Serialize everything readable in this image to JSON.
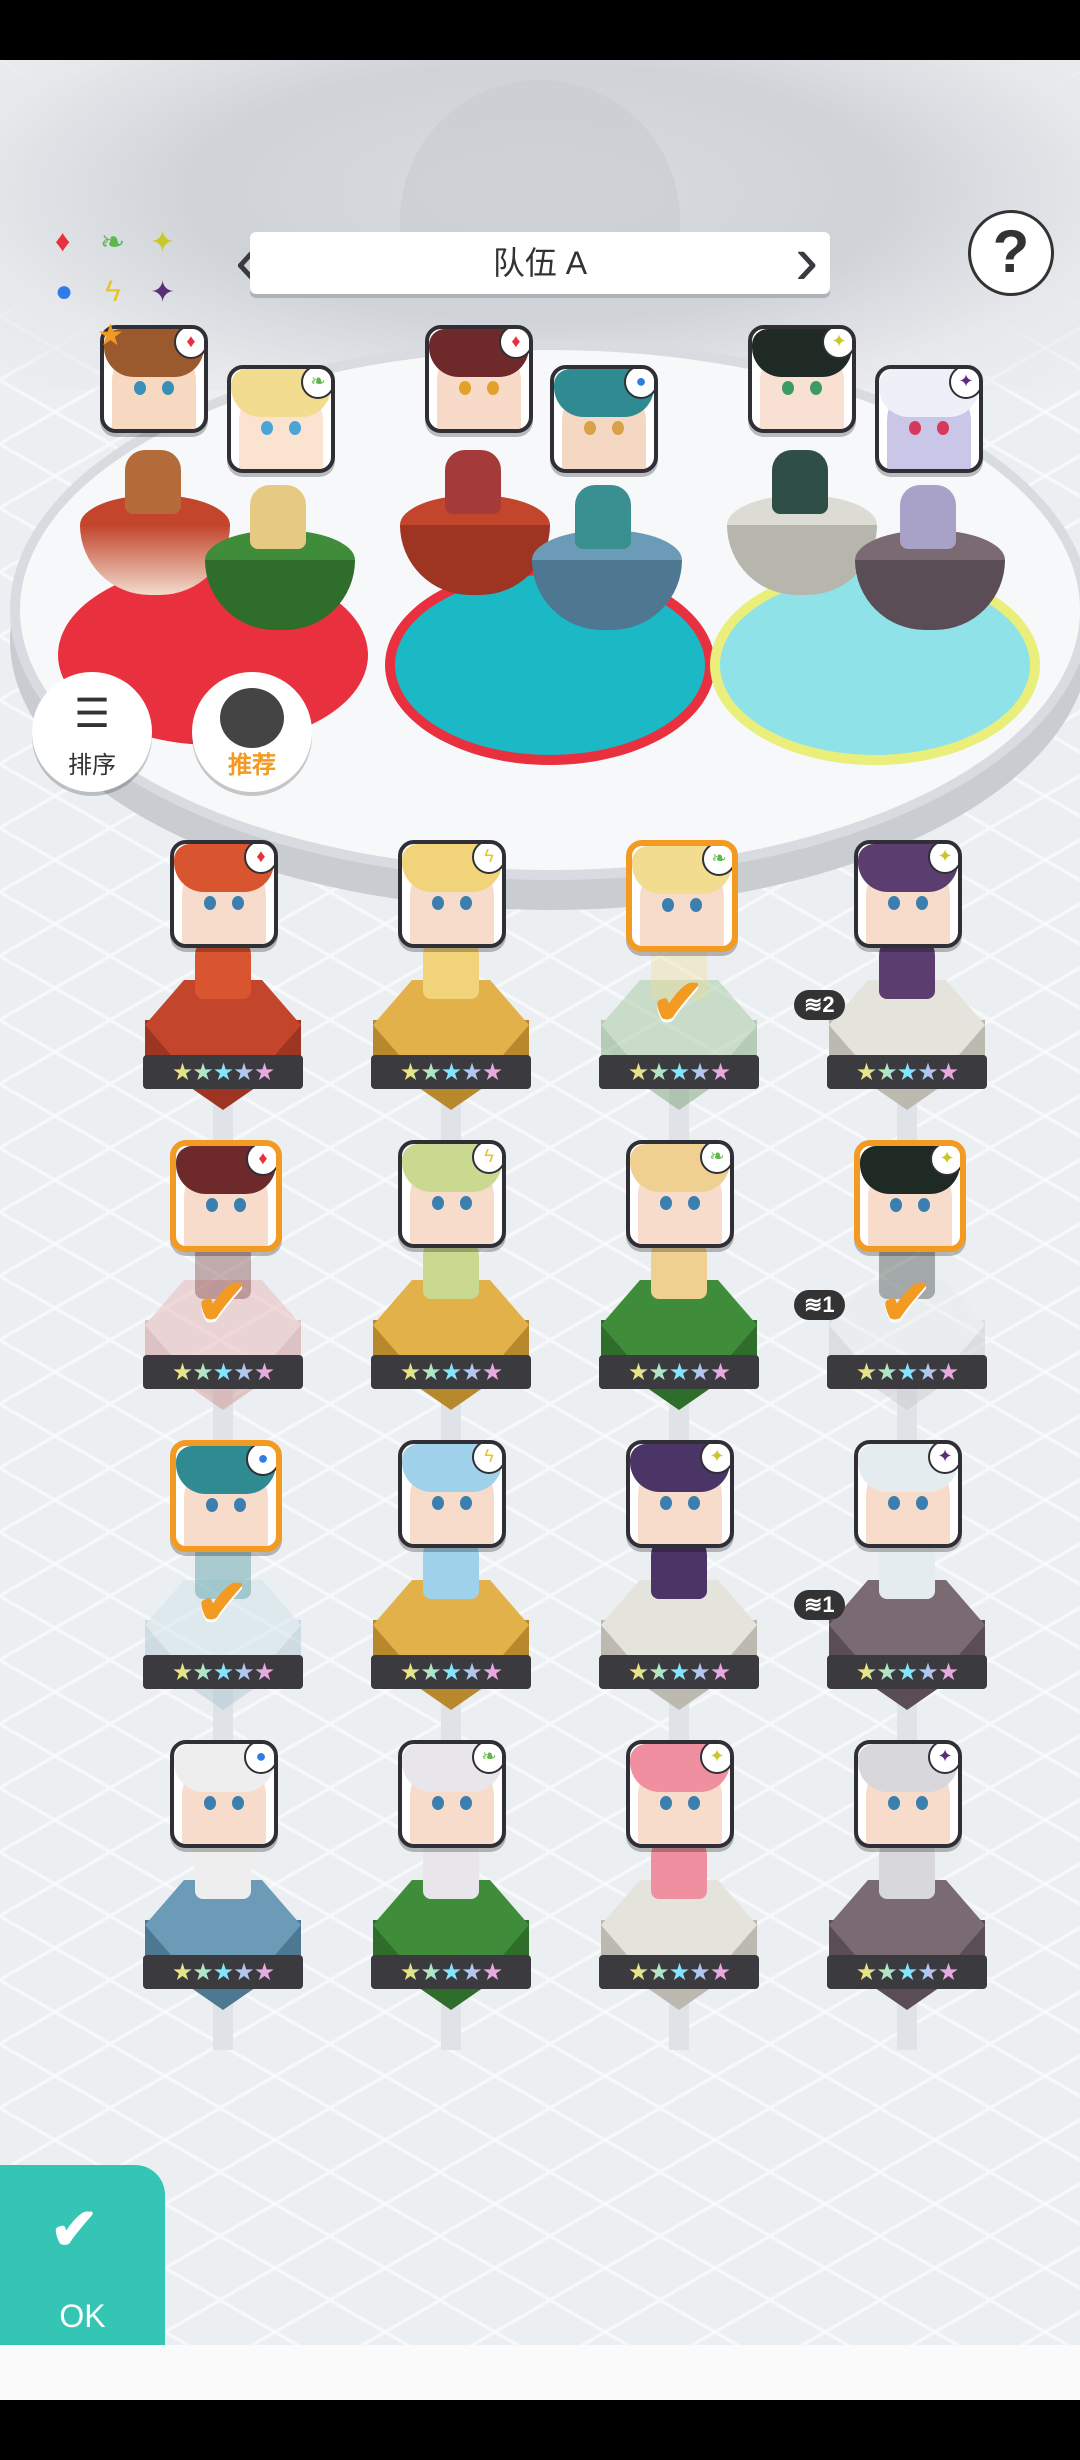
{
  "team": {
    "title": "队伍 A",
    "prev_icon": "chevron-left-icon",
    "next_icon": "chevron-right-icon"
  },
  "help": {
    "icon": "question-mark-icon",
    "label": "?"
  },
  "element_legend": {
    "icons": [
      "diamond-red-icon",
      "leaf-green-icon",
      "sparkle-yellow-icon",
      "circle-blue-icon",
      "lightning-yellow-icon",
      "sparkle-purple-icon"
    ]
  },
  "buttons": {
    "sort_label": "排序",
    "recommend_label": "推荐",
    "ok_label": "OK",
    "ok_icon": "checkmark-icon"
  },
  "team_slots": [
    {
      "name": "brown-haired-boy",
      "element": "diamond-red",
      "leader": true
    },
    {
      "name": "blonde-girl",
      "element": "leaf-green"
    },
    {
      "name": "auburn-girl",
      "element": "diamond-red"
    },
    {
      "name": "teal-haired-boy",
      "element": "circle-blue"
    },
    {
      "name": "black-haired-girl",
      "element": "sparkle-yellow"
    },
    {
      "name": "white-haired-demon-girl",
      "element": "sparkle-purple"
    }
  ],
  "roster": [
    {
      "name": "red-dragon",
      "element": "diamond-red",
      "selected": false,
      "stars": "★★★★★"
    },
    {
      "name": "blonde-cat-girl",
      "element": "lightning-yellow",
      "selected": false,
      "stars": "★★★★★"
    },
    {
      "name": "blonde-girl",
      "element": "leaf-green",
      "selected": true,
      "stars": "★★★★★"
    },
    {
      "name": "dark-skinned-girl",
      "element": "sparkle-yellow",
      "selected": false,
      "count": "2",
      "stars": "★★★★★"
    },
    {
      "name": "auburn-girl",
      "element": "diamond-red",
      "selected": true,
      "stars": "★★★★★"
    },
    {
      "name": "blonde-winking-girl",
      "element": "lightning-yellow",
      "selected": false,
      "stars": "★★★★★"
    },
    {
      "name": "hat-girl",
      "element": "leaf-green",
      "selected": false,
      "stars": "★★★★★"
    },
    {
      "name": "black-haired-girl",
      "element": "sparkle-yellow",
      "selected": true,
      "count": "1",
      "stars": "★★★★★"
    },
    {
      "name": "teal-haired-boy",
      "element": "circle-blue",
      "selected": true,
      "stars": "★★★★★"
    },
    {
      "name": "blue-haired-girl",
      "element": "lightning-yellow",
      "selected": false,
      "stars": "★★★★★"
    },
    {
      "name": "purple-haired-girl",
      "element": "sparkle-yellow",
      "selected": false,
      "stars": "★★★★★"
    },
    {
      "name": "silver-haired-girl",
      "element": "sparkle-purple",
      "selected": false,
      "count": "1",
      "stars": "★★★★★"
    },
    {
      "name": "dark-elf-girl",
      "element": "circle-blue",
      "selected": false,
      "stars": "★★★★★"
    },
    {
      "name": "white-haired-girl",
      "element": "leaf-green",
      "selected": false,
      "stars": "★★★★★"
    },
    {
      "name": "pink-haired-girl",
      "element": "sparkle-yellow",
      "selected": false,
      "stars": "★★★★★"
    },
    {
      "name": "eyepatch-girl",
      "element": "sparkle-purple",
      "selected": false,
      "stars": "★★★★★"
    }
  ],
  "colors": {
    "accent": "#f39a22",
    "ok_button": "#35c5b5",
    "red": "#e8303f",
    "teal": "#1bb8c6"
  }
}
